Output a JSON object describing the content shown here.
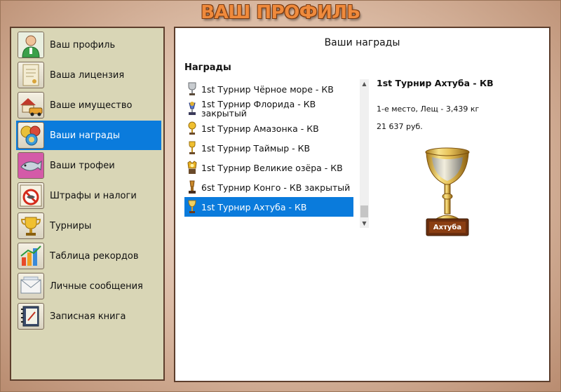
{
  "header": {
    "title": "ВАШ ПРОФИЛЬ"
  },
  "sidebar": {
    "items": [
      {
        "label": "Ваш профиль",
        "icon": "user-profile-icon",
        "active": false
      },
      {
        "label": "Ваша лицензия",
        "icon": "license-certificate-icon",
        "active": false
      },
      {
        "label": "Ваше имущество",
        "icon": "property-house-car-icon",
        "active": false
      },
      {
        "label": "Ваши награды",
        "icon": "awards-medals-icon",
        "active": true
      },
      {
        "label": "Ваши трофеи",
        "icon": "fish-trophy-icon",
        "active": false
      },
      {
        "label": "Штрафы и налоги",
        "icon": "fines-no-fishing-icon",
        "active": false
      },
      {
        "label": "Турниры",
        "icon": "tournament-cup-icon",
        "active": false
      },
      {
        "label": "Таблица рекордов",
        "icon": "records-chart-icon",
        "active": false
      },
      {
        "label": "Личные сообщения",
        "icon": "messages-envelope-icon",
        "active": false
      },
      {
        "label": "Записная книга",
        "icon": "notebook-icon",
        "active": false
      }
    ]
  },
  "main": {
    "title": "Ваши награды",
    "awards_heading": "Награды",
    "awards": [
      {
        "label": "1st Турнир Чёрное море - КВ",
        "icon": "silver-trophy-icon",
        "selected": false
      },
      {
        "label": "1st Турнир Флорида - КВ\nзакрытый",
        "icon": "blue-trophy-icon",
        "selected": false
      },
      {
        "label": "1st Турнир Амазонка - КВ",
        "icon": "gold-globe-trophy-icon",
        "selected": false
      },
      {
        "label": "1st Турнир Таймыр - КВ",
        "icon": "gold-cup-trophy-icon",
        "selected": false
      },
      {
        "label": "1st Турнир Великие озёра - КВ",
        "icon": "gold-medal-trophy-icon",
        "selected": false
      },
      {
        "label": "6st Турнир Конго - КВ закрытый",
        "icon": "bronze-trophy-icon",
        "selected": false
      },
      {
        "label": "1st Турнир Ахтуба - КВ",
        "icon": "gold-chalice-trophy-icon",
        "selected": true
      }
    ],
    "detail": {
      "title": "1st Турнир Ахтуба - КВ",
      "place": "1-е место, Лещ - 3,439 кг",
      "prize": "21 637 руб.",
      "trophy_plate": "Ахтуба"
    }
  },
  "colors": {
    "accent": "#0a7bdc",
    "sidebar_bg": "#d9d6b6",
    "header_text": "#ef8a3c",
    "frame": "#5d3e2c"
  }
}
